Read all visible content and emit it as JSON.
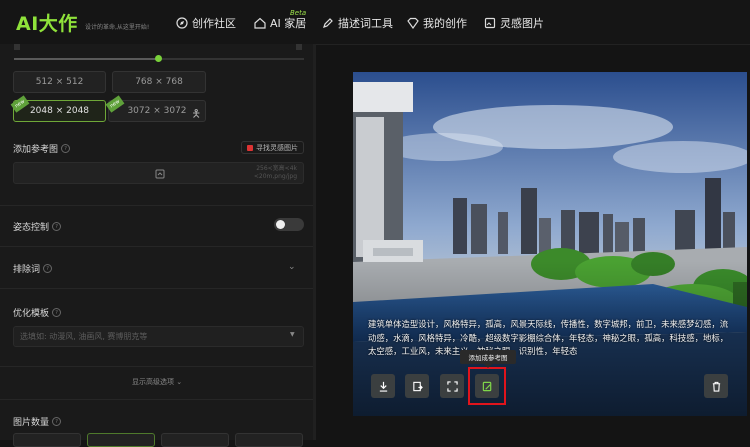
{
  "app": {
    "logo": "AI大作",
    "slogan": "设计的革命,从这里开始!"
  },
  "nav": [
    {
      "label": "创作社区",
      "icon": "compass-icon"
    },
    {
      "label": "AI 家居",
      "icon": "home-icon"
    },
    {
      "label": "描述词工具",
      "icon": "pencil-icon"
    },
    {
      "label": "我的创作",
      "icon": "diamond-icon"
    },
    {
      "label": "灵感图片",
      "icon": "image-icon"
    }
  ],
  "beta_label": "Beta",
  "sizes": [
    {
      "label": "512 × 512"
    },
    {
      "label": "768 × 768"
    },
    {
      "label": "2048 × 2048",
      "tag": "new",
      "selected": true
    },
    {
      "label": "3072 × 3072",
      "tag": "new"
    }
  ],
  "ref_image": {
    "label": "添加参考图",
    "find_button": "寻找灵感图片",
    "hint_line1": "256<宽高<4k",
    "hint_line2": "<20m,png/jpg"
  },
  "pose": {
    "label": "姿态控制",
    "enabled": false
  },
  "exclude": {
    "label": "排除词"
  },
  "template": {
    "label": "优化模板",
    "placeholder": "选填如: 动漫风, 油画风, 赛博朋克等"
  },
  "advanced": {
    "label": "显示高级选项"
  },
  "image_count": {
    "label": "图片数量"
  },
  "preview": {
    "description": "建筑单体造型设计，风格特异，孤高，风景天际线，传播性，数字城邦，前卫，未来感梦幻感，流动感，水滴，风格特异，冷酷，超级数字影棚综合体，年轻态，神秘之眼，孤高，科技感，地标，太空感，工业风，未来主义，神秘之眼，识别性，年轻态",
    "tooltip": "添加成参考图",
    "actions": [
      "download-icon",
      "export-icon",
      "expand-icon",
      "add-reference-icon",
      "trash-icon"
    ]
  },
  "colors": {
    "accent": "#8fe23a",
    "highlight": "#e0141c",
    "background": "#141414"
  }
}
